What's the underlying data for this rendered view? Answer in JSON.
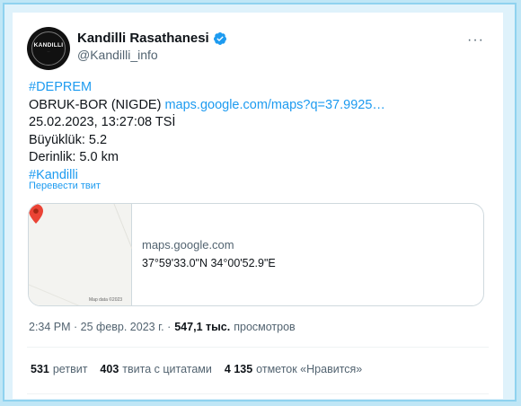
{
  "account": {
    "display_name": "Kandilli Rasathanesi",
    "handle": "@Kandilli_info",
    "avatar_brand": "KANDILLI",
    "verified": true,
    "more_label": "···"
  },
  "tweet": {
    "hashtag1": "#DEPREM",
    "location": "OBRUK-BOR (NIGDE) ",
    "location_link": "maps.google.com/maps?q=37.9925…",
    "datetime": "25.02.2023, 13:27:08 TSİ",
    "magnitude": "Büyüklük: 5.2",
    "depth": "Derinlik: 5.0 km",
    "hashtag2": "#Kandilli",
    "translate_label": "Перевести твит"
  },
  "link_card": {
    "domain": "maps.google.com",
    "title": "37°59'33.0\"N 34°00'52.9\"E",
    "map_credit": "Map data ©2023"
  },
  "meta": {
    "timestamp": "2:34 PM · 25 февр. 2023 г. ·",
    "views_count": "547,1 тыс.",
    "views_label": "просмотров"
  },
  "stats": [
    {
      "count": "531",
      "label": "ретвит"
    },
    {
      "count": "403",
      "label": "твита с цитатами"
    },
    {
      "count": "4 135",
      "label": "отметок «Нравится»"
    }
  ],
  "colors": {
    "accent": "#1d9bf0",
    "background": "#bfe6f6",
    "text": "#0f1419",
    "muted": "#536471"
  },
  "icons": {
    "verified": "verified-badge-icon",
    "more": "more-options-icon",
    "pin": "map-pin-icon"
  }
}
